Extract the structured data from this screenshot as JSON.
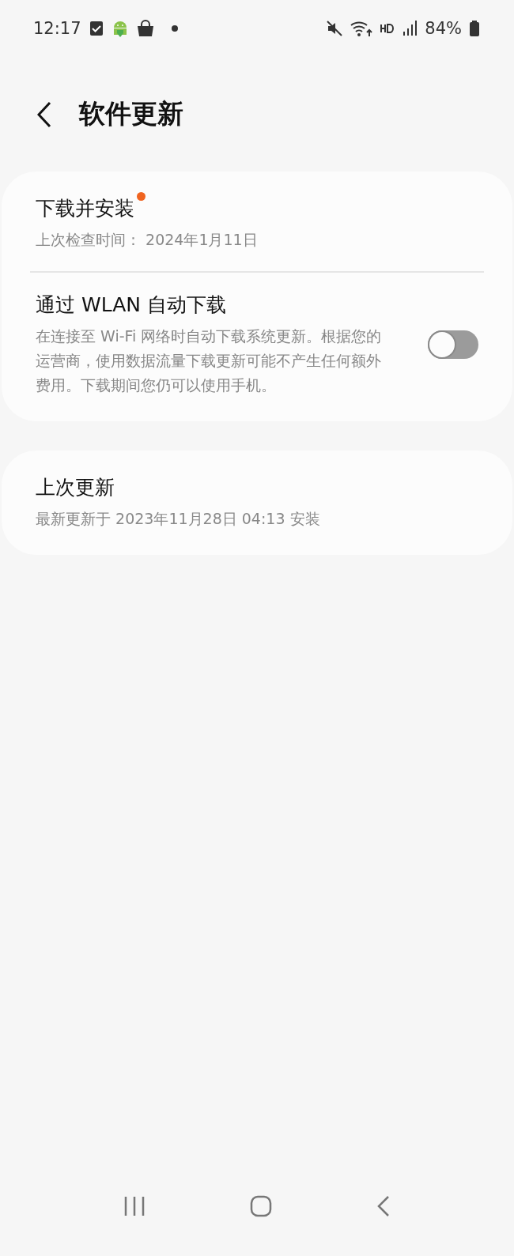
{
  "status_bar": {
    "time": "12:17",
    "battery": "84%"
  },
  "header": {
    "title": "软件更新"
  },
  "cards": [
    {
      "items": [
        {
          "kind": "text",
          "title": "下载并安装",
          "badge": true,
          "subtitle": "上次检查时间： 2024年1月11日"
        },
        {
          "kind": "switch",
          "title": "通过 WLAN 自动下载",
          "subtitle": "在连接至 Wi-Fi 网络时自动下载系统更新。根据您的运营商，使用数据流量下载更新可能不产生任何额外费用。下载期间您仍可以使用手机。",
          "on": false
        }
      ]
    },
    {
      "items": [
        {
          "kind": "text",
          "title": "上次更新",
          "badge": false,
          "subtitle": "最新更新于 2023年11月28日 04:13 安装"
        }
      ]
    }
  ]
}
